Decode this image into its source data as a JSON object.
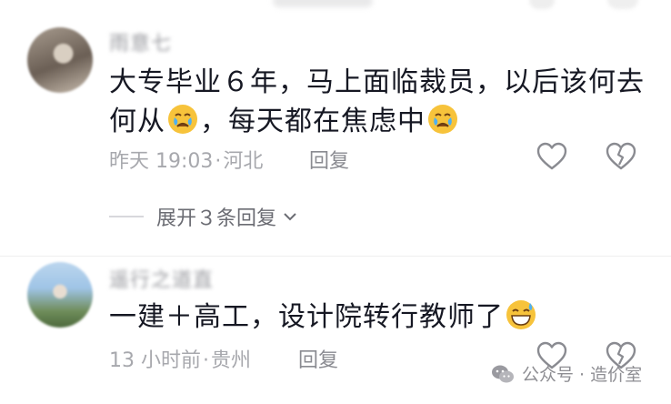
{
  "comments": [
    {
      "username": "雨意七",
      "text_parts": [
        "大专毕业６年，马上面临裁员，以后该何去",
        "何从",
        "，每天都在焦虑中"
      ],
      "emoji_inline": "crying-face",
      "time": "昨天 19:03",
      "location": "河北",
      "reply_label": "回复",
      "expand_label": "展开３条回复"
    },
    {
      "username": "遥行之道直",
      "text": "一建＋高工，设计院转行教师了",
      "emoji_inline": "grinning-sweat-face",
      "time": "13 小时前",
      "location": "贵州",
      "reply_label": "回复"
    }
  ],
  "separator": "·",
  "watermark": {
    "text": "公众号 · 造价室"
  }
}
